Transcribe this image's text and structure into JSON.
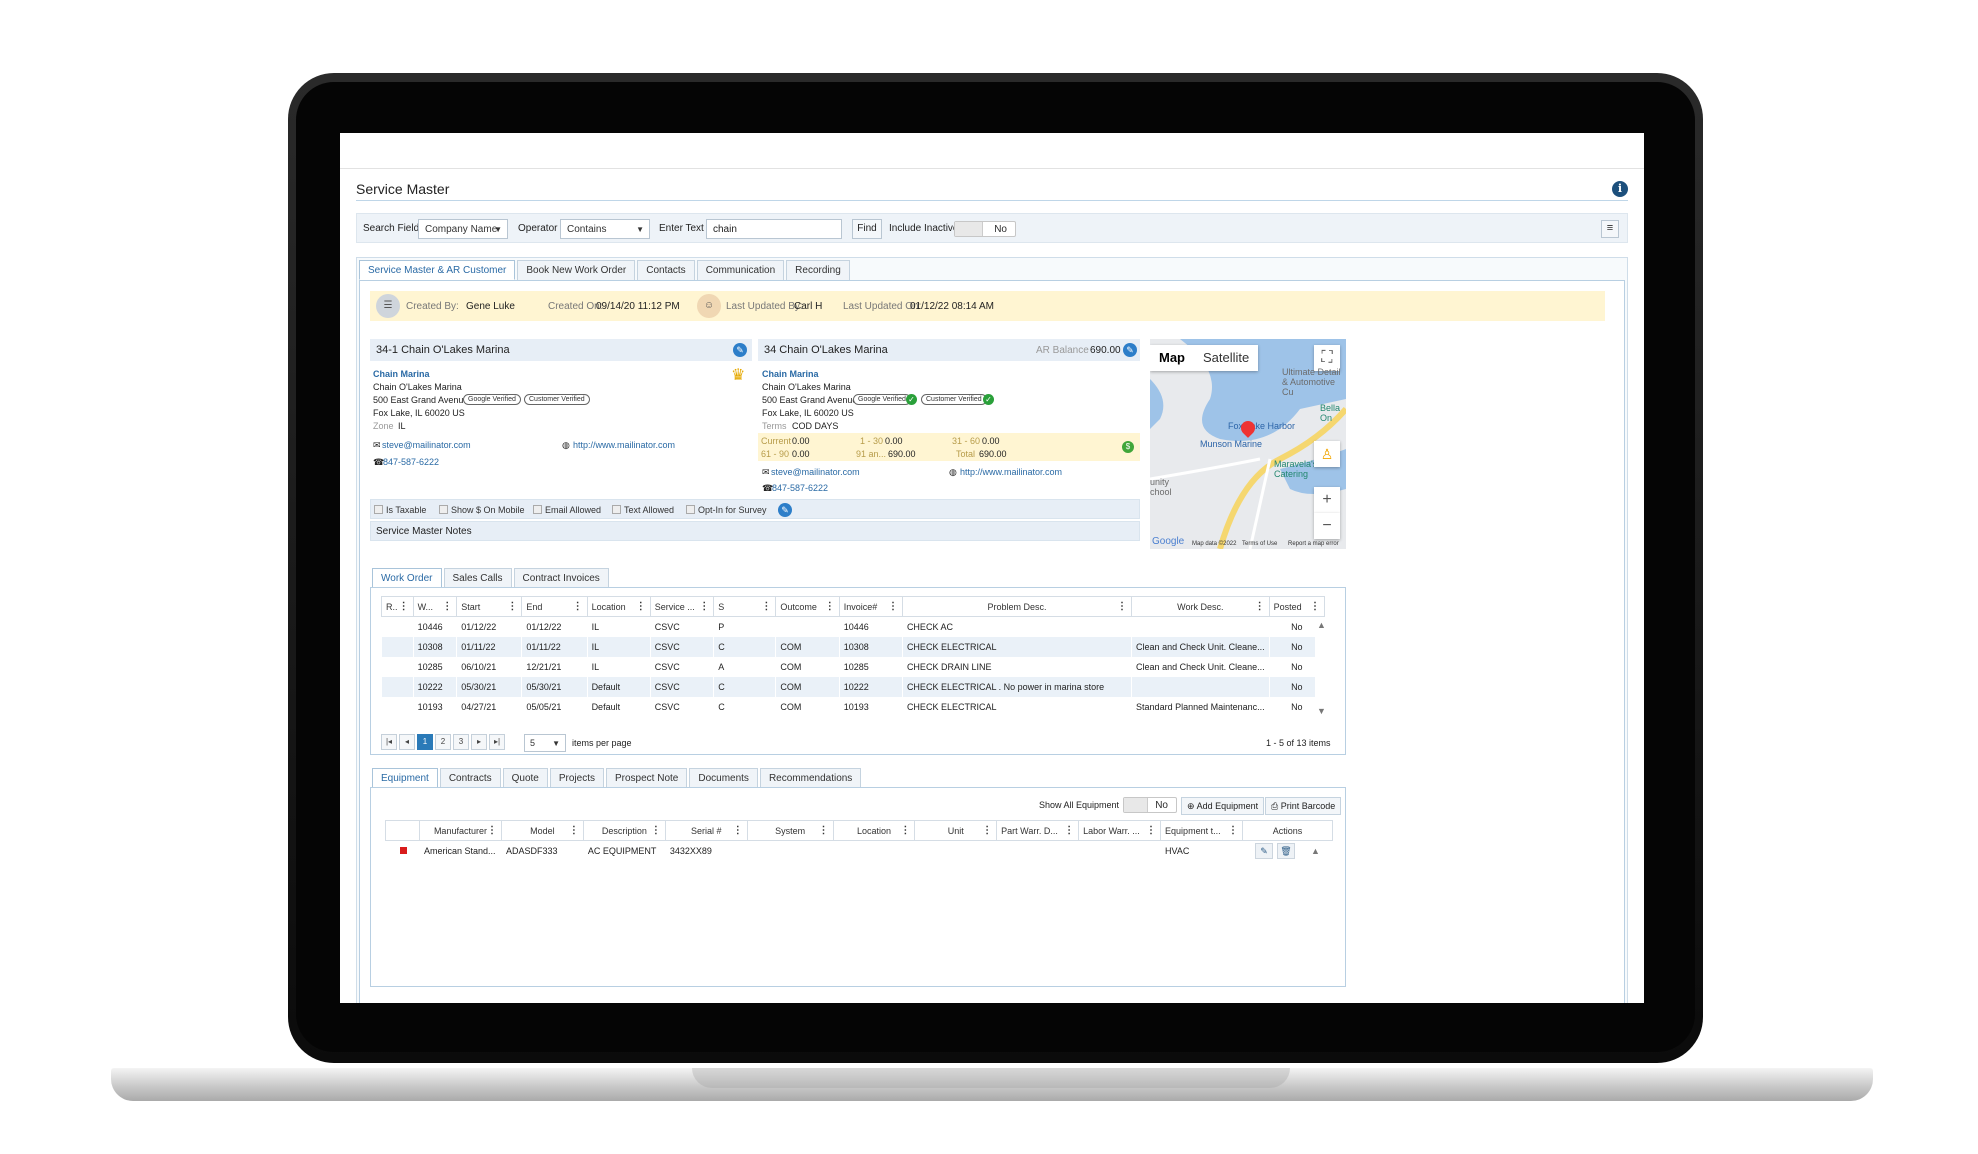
{
  "page": {
    "title": "Service Master"
  },
  "search": {
    "field_label": "Search Field",
    "field_value": "Company Name",
    "operator_label": "Operator",
    "operator_value": "Contains",
    "text_label": "Enter Text",
    "text_value": "chain",
    "find_label": "Find",
    "include_inactive_label": "Include Inactive",
    "include_inactive_value": "No"
  },
  "main_tabs": [
    "Service Master & AR Customer",
    "Book New Work Order",
    "Contacts",
    "Communication",
    "Recording"
  ],
  "audit": {
    "created_by_label": "Created By:",
    "created_by": "Gene Luke",
    "created_on_label": "Created On:",
    "created_on": "09/14/20 11:12 PM",
    "updated_by_label": "Last Updated By:",
    "updated_by": "Carl H",
    "updated_on_label": "Last Updated On:",
    "updated_on": "01/12/22 08:14 AM"
  },
  "service_master": {
    "header": "34-1 Chain O'Lakes Marina",
    "name": "Chain Marina",
    "company": "Chain O'Lakes Marina",
    "address1": "500 East Grand Avenue",
    "address2": "Fox Lake, IL 60020 US",
    "google_verified": "Google Verified",
    "customer_verified": "Customer Verified",
    "zone_label": "Zone",
    "zone": "IL",
    "email": "steve@mailinator.com",
    "website": "http://www.mailinator.com",
    "phone": "847-587-6222"
  },
  "ar_customer": {
    "header": "34 Chain O'Lakes Marina",
    "balance_label": "AR Balance",
    "balance": "690.00",
    "name": "Chain Marina",
    "company": "Chain O'Lakes Marina",
    "address1": "500 East Grand Avenue,",
    "address2": "Fox Lake, IL 60020 US",
    "google_verified": "Google Verified",
    "customer_verified": "Customer Verified",
    "terms_label": "Terms",
    "terms": "COD DAYS",
    "aging": {
      "current_label": "Current",
      "current": "0.00",
      "d1_30_label": "1 - 30",
      "d1_30": "0.00",
      "d31_60_label": "31 - 60",
      "d31_60": "0.00",
      "d61_90_label": "61 - 90",
      "d61_90": "0.00",
      "d91_label": "91 an...",
      "d91": "690.00",
      "total_label": "Total",
      "total": "690.00"
    },
    "email": "steve@mailinator.com",
    "website": "http://www.mailinator.com",
    "phone": "847-587-6222"
  },
  "flags": [
    "Is Taxable",
    "Show $ On Mobile",
    "Email Allowed",
    "Text Allowed",
    "Opt-In for Survey"
  ],
  "notes_label": "Service Master Notes",
  "map": {
    "map_label": "Map",
    "satellite_label": "Satellite",
    "labels": {
      "fox_harbor": "Fox Lake Harbor",
      "munson": "Munson Marine",
      "ultimate": "Ultimate Detail & Automotive Cu",
      "bella": "Bella On",
      "maravela": "Maravela's & Catering",
      "school": "unity chool"
    },
    "footer_data": "Map data ©2022",
    "footer_terms": "Terms of Use",
    "footer_report": "Report a map error",
    "google": "Google"
  },
  "wo_tabs": [
    "Work Order",
    "Sales Calls",
    "Contract Invoices"
  ],
  "wo_table": {
    "columns": [
      "R..",
      "W...",
      "Start",
      "End",
      "Location",
      "Service ...",
      "S",
      "Outcome",
      "Invoice#",
      "Problem Desc.",
      "Work Desc.",
      "Posted"
    ],
    "rows": [
      [
        "",
        "10446",
        "01/12/22",
        "01/12/22",
        "IL",
        "CSVC",
        "P",
        "",
        "10446",
        "CHECK AC",
        "",
        "No"
      ],
      [
        "",
        "10308",
        "01/11/22",
        "01/11/22",
        "IL",
        "CSVC",
        "C",
        "COM",
        "10308",
        "CHECK ELECTRICAL",
        "Clean and Check Unit. Cleane...",
        "No"
      ],
      [
        "",
        "10285",
        "06/10/21",
        "12/21/21",
        "IL",
        "CSVC",
        "A",
        "COM",
        "10285",
        "CHECK DRAIN LINE",
        "Clean and Check Unit. Cleane...",
        "No"
      ],
      [
        "",
        "10222",
        "05/30/21",
        "05/30/21",
        "Default",
        "CSVC",
        "C",
        "COM",
        "10222",
        "CHECK ELECTRICAL . No power in marina store",
        "",
        "No"
      ],
      [
        "",
        "10193",
        "04/27/21",
        "05/05/21",
        "Default",
        "CSVC",
        "C",
        "COM",
        "10193",
        "CHECK ELECTRICAL",
        "Standard Planned Maintenanc...",
        "No"
      ]
    ],
    "pages": [
      "1",
      "2",
      "3"
    ],
    "page_size": "5",
    "items_per_page": "items per page",
    "summary": "1 - 5 of 13 items"
  },
  "equip_tabs": [
    "Equipment",
    "Contracts",
    "Quote",
    "Projects",
    "Prospect Note",
    "Documents",
    "Recommendations"
  ],
  "equipment": {
    "show_all_label": "Show All Equipment",
    "show_all_value": "No",
    "add_label": "Add Equipment",
    "barcode_label": "Print Barcode",
    "columns": [
      "",
      "Manufacturer",
      "Model",
      "Description",
      "Serial #",
      "System",
      "Location",
      "Unit",
      "Part Warr. D...",
      "Labor Warr. ...",
      "Equipment t...",
      "Actions"
    ],
    "rows": [
      [
        "",
        "American Stand...",
        "ADASDF333",
        "AC EQUIPMENT",
        "3432XX89",
        "",
        "",
        "",
        "",
        "",
        "HVAC",
        ""
      ]
    ],
    "status_color": "#d91c1c"
  },
  "colors": {
    "accent": "#2a7ab8",
    "audit_bg": "#fff5d2",
    "header_bg": "#e7eef6"
  }
}
